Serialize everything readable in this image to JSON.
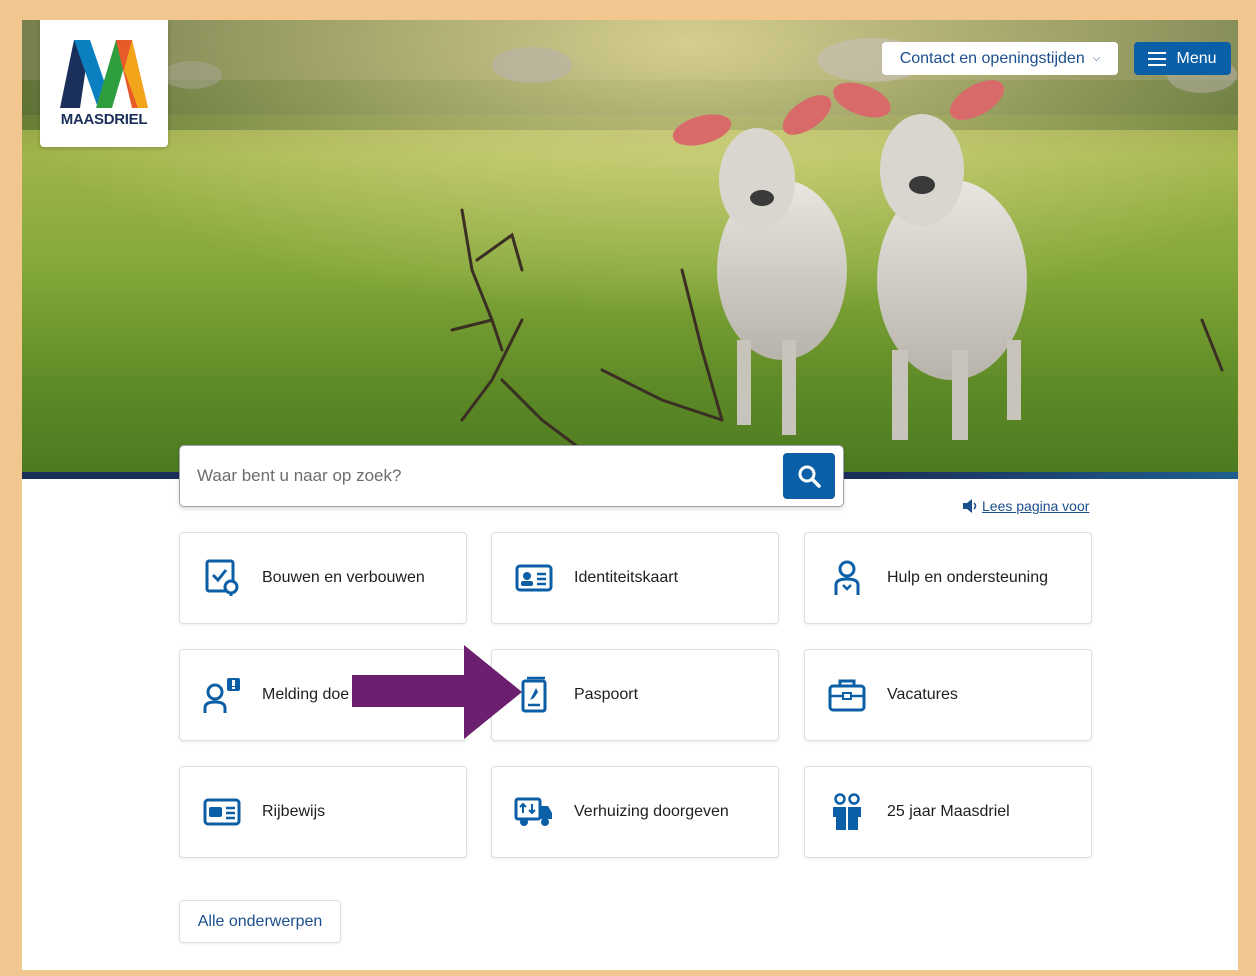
{
  "header": {
    "logo_text": "MAASDRIEL",
    "contact_label": "Contact en openingstijden",
    "menu_label": "Menu"
  },
  "search": {
    "placeholder": "Waar bent u naar op zoek?"
  },
  "read_aloud": {
    "label": "Lees pagina voor"
  },
  "tiles": [
    {
      "label": "Bouwen en verbouwen",
      "icon": "building-permit-icon"
    },
    {
      "label": "Identiteitskaart",
      "icon": "id-card-icon"
    },
    {
      "label": "Hulp en ondersteuning",
      "icon": "support-person-icon"
    },
    {
      "label": "Melding doe",
      "icon": "report-person-icon"
    },
    {
      "label": "Paspoort",
      "icon": "passport-icon"
    },
    {
      "label": "Vacatures",
      "icon": "briefcase-icon"
    },
    {
      "label": "Rijbewijs",
      "icon": "drivers-license-icon"
    },
    {
      "label": "Verhuizing doorgeven",
      "icon": "moving-truck-icon"
    },
    {
      "label": "25 jaar Maasdriel",
      "icon": "anniversary-people-icon"
    }
  ],
  "all_topics_label": "Alle onderwerpen",
  "colors": {
    "brand_blue": "#0b5fa6",
    "navy": "#1b2f5b",
    "frame": "#f2c78f",
    "annotation_arrow": "#6b1f6e"
  }
}
